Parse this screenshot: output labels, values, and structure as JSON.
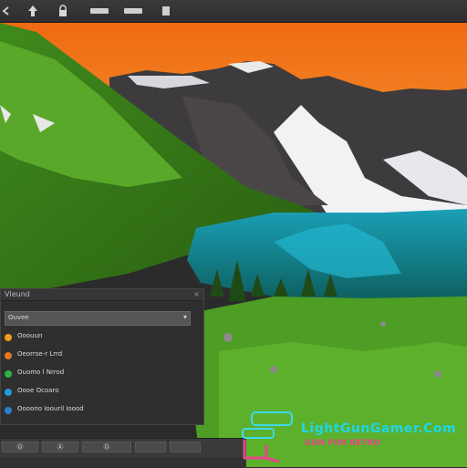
{
  "toolbar": {
    "buttons": [
      {
        "icon": "arrow-left-icon"
      },
      {
        "icon": "up-arrow-icon"
      },
      {
        "icon": "lock-icon"
      },
      {
        "icon": "minimize-icon"
      },
      {
        "icon": "minimize-icon"
      },
      {
        "icon": "square-icon"
      }
    ]
  },
  "panel": {
    "title": "Vleund",
    "close_label": "×",
    "search_label": "Ouvee",
    "items": [
      {
        "label": "Ooouun",
        "color": "#f29a1a"
      },
      {
        "label": "Oeorrse-r Lrrd",
        "color": "#e07a1a"
      },
      {
        "label": "Ouomo l Nrrod",
        "color": "#2bb34a"
      },
      {
        "label": "Oooe Ocoaro",
        "color": "#1f9bd8"
      },
      {
        "label": "Oooono Ioouril Ioood",
        "color": "#2a7fd0"
      }
    ]
  },
  "taskbar": {
    "buttons": [
      {
        "label": "Ⓞ"
      },
      {
        "label": "Ⓐ"
      },
      {
        "label": "Ⓞ"
      },
      {
        "label": ""
      },
      {
        "label": ""
      }
    ]
  },
  "watermark": {
    "text": "LightGunGamer.Com",
    "subtext": "GUN FOR RETRO"
  },
  "colors": {
    "sky_top": "#f06a12",
    "sky_bottom": "#f4a23a",
    "grass": "#4e9d24",
    "lake": "#1aa0b8",
    "accent": "#1fd6e8"
  }
}
